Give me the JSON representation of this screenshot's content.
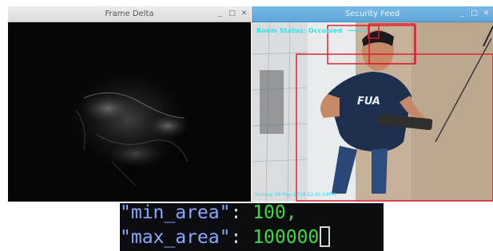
{
  "windows": {
    "delta": {
      "title": "Frame Delta",
      "controls": {
        "minimize": "_",
        "maximize": "□",
        "close": "✕"
      }
    },
    "feed": {
      "title": "Security Feed",
      "controls": {
        "minimize": "_",
        "maximize": "□",
        "close": "✕"
      },
      "status_text": "Room Status: Occupied",
      "timestamp_text": "Sunday 26 May 2018 12:41:04PM"
    }
  },
  "code": {
    "line1": {
      "key": "\"min_area\"",
      "sep": ": ",
      "value": "100",
      "trail": ","
    },
    "line2": {
      "key": "\"max_area\"",
      "sep": ": ",
      "value": "100000"
    }
  },
  "colors": {
    "detection_box": "#e0182a",
    "status_text": "#27e7ef",
    "code_key": "#8aa7ff",
    "code_value": "#3cdc40",
    "code_background": "#0c0d10"
  }
}
